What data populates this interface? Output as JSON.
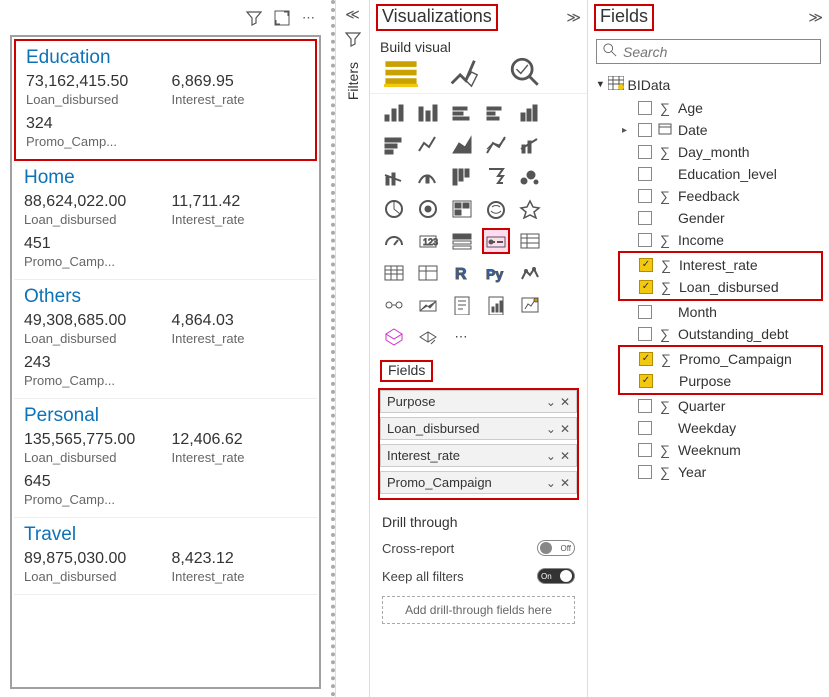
{
  "canvas": {
    "cards": [
      {
        "title": "Education",
        "loan": "73,162,415.50",
        "rate": "6,869.95",
        "promo": "324",
        "highlight": true
      },
      {
        "title": "Home",
        "loan": "88,624,022.00",
        "rate": "11,711.42",
        "promo": "451"
      },
      {
        "title": "Others",
        "loan": "49,308,685.00",
        "rate": "4,864.03",
        "promo": "243"
      },
      {
        "title": "Personal",
        "loan": "135,565,775.00",
        "rate": "12,406.62",
        "promo": "645"
      },
      {
        "title": "Travel",
        "loan": "89,875,030.00",
        "rate": "8,423.12"
      }
    ],
    "labels": {
      "loan": "Loan_disbursed",
      "rate": "Interest_rate",
      "promo": "Promo_Camp..."
    }
  },
  "filters_label": "Filters",
  "viz": {
    "title": "Visualizations",
    "build": "Build visual",
    "fields_label": "Fields",
    "wells": [
      "Purpose",
      "Loan_disbursed",
      "Interest_rate",
      "Promo_Campaign"
    ],
    "drill_title": "Drill through",
    "cross_report": "Cross-report",
    "keep_filters": "Keep all filters",
    "off": "Off",
    "on": "On",
    "drill_placeholder": "Add drill-through fields here"
  },
  "fields": {
    "title": "Fields",
    "search_placeholder": "Search",
    "table": "BIData",
    "items": [
      {
        "name": "Age",
        "sigma": true
      },
      {
        "name": "Date",
        "sigma": false,
        "expandable": true,
        "icon": "date"
      },
      {
        "name": "Day_month",
        "sigma": true
      },
      {
        "name": "Education_level",
        "sigma": false
      },
      {
        "name": "Feedback",
        "sigma": true
      },
      {
        "name": "Gender",
        "sigma": false
      },
      {
        "name": "Income",
        "sigma": true
      },
      {
        "name": "Interest_rate",
        "sigma": true,
        "checked": true,
        "red": "group1"
      },
      {
        "name": "Loan_disbursed",
        "sigma": true,
        "checked": true,
        "red": "group1"
      },
      {
        "name": "Month",
        "sigma": false
      },
      {
        "name": "Outstanding_debt",
        "sigma": true
      },
      {
        "name": "Promo_Campaign",
        "sigma": true,
        "checked": true,
        "red": "group2"
      },
      {
        "name": "Purpose",
        "sigma": false,
        "checked": true,
        "red": "group2"
      },
      {
        "name": "Quarter",
        "sigma": true
      },
      {
        "name": "Weekday",
        "sigma": false
      },
      {
        "name": "Weeknum",
        "sigma": true
      },
      {
        "name": "Year",
        "sigma": true
      }
    ]
  }
}
